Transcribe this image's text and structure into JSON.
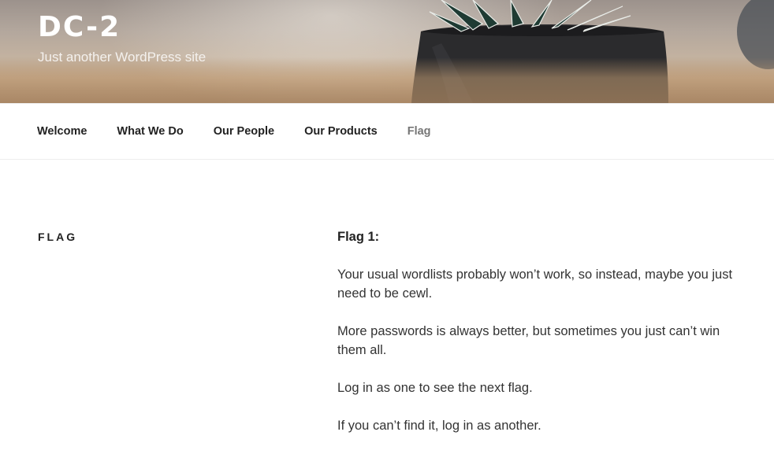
{
  "header": {
    "site_title": "DC-2",
    "tagline": "Just another WordPress site"
  },
  "nav": {
    "items": [
      {
        "label": "Welcome",
        "current": false
      },
      {
        "label": "What We Do",
        "current": false
      },
      {
        "label": "Our People",
        "current": false
      },
      {
        "label": "Our Products",
        "current": false
      },
      {
        "label": "Flag",
        "current": true
      }
    ]
  },
  "page": {
    "title": "FLAG",
    "heading": "Flag 1:",
    "paragraphs": [
      "Your usual wordlists probably won’t work, so instead, maybe you just need to be cewl.",
      "More passwords is always better, but sometimes you just can’t win them all.",
      "Log in as one to see the next flag.",
      "If you can’t find it, log in as another."
    ]
  },
  "colors": {
    "nav_text": "#222222",
    "nav_current": "#767676",
    "body_text": "#333333",
    "header_text": "#ffffff"
  }
}
